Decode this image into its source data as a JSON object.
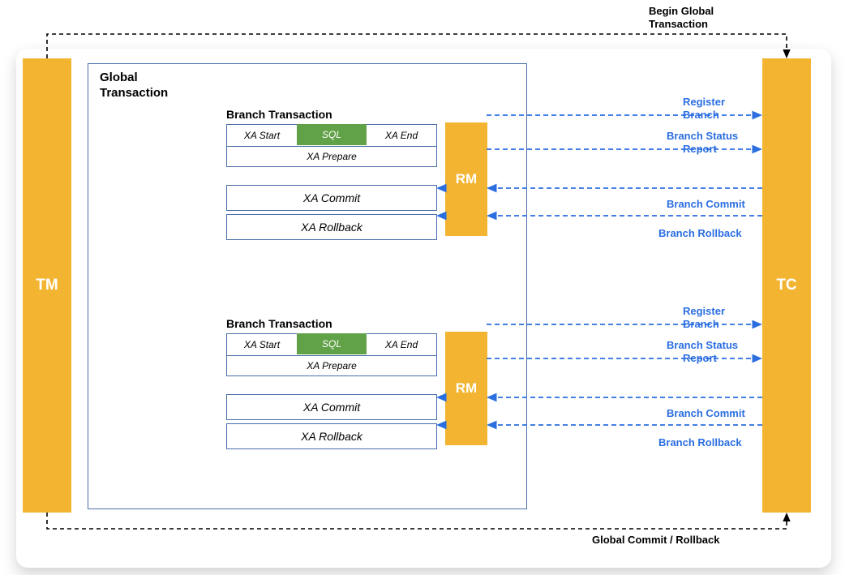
{
  "tm": "TM",
  "tc": "TC",
  "global_title": "Global\nTransaction",
  "branch_title": "Branch Transaction",
  "xa": {
    "start": "XA Start",
    "sql": "SQL",
    "end": "XA End",
    "prepare": "XA Prepare",
    "commit": "XA Commit",
    "rollback": "XA Rollback"
  },
  "rm": "RM",
  "connectors": {
    "register1": "Register",
    "branch1": "Branch",
    "status1": "Branch Status",
    "report1": "Report",
    "commit1": "Branch Commit",
    "rollback1": "Branch Rollback",
    "register2": "Register",
    "branch2": "Branch",
    "status2": "Branch Status",
    "report2": "Report",
    "commit2": "Branch Commit",
    "rollback2": "Branch Rollback"
  },
  "black": {
    "begin": "Begin Global\nTransaction",
    "end": "Global Commit / Rollback"
  }
}
